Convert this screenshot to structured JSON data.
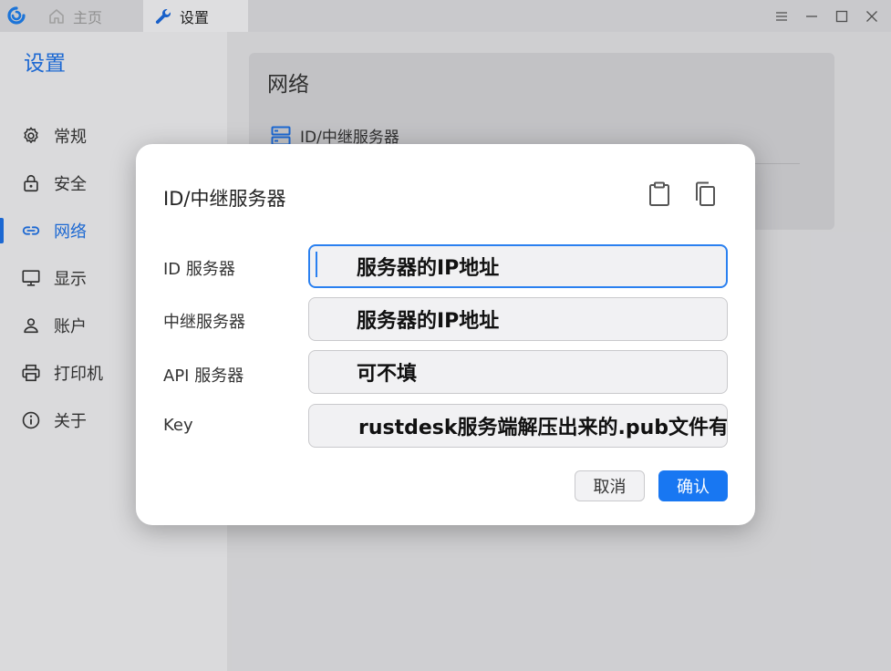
{
  "titlebar": {
    "tabs": [
      {
        "label": "主页",
        "icon": "home-icon"
      },
      {
        "label": "设置",
        "icon": "wrench-icon"
      }
    ]
  },
  "sidebar": {
    "title": "设置",
    "items": [
      {
        "label": "常规",
        "icon": "gear-icon"
      },
      {
        "label": "安全",
        "icon": "lock-icon"
      },
      {
        "label": "网络",
        "icon": "link-icon",
        "active": true
      },
      {
        "label": "显示",
        "icon": "monitor-icon"
      },
      {
        "label": "账户",
        "icon": "user-icon"
      },
      {
        "label": "打印机",
        "icon": "printer-icon"
      },
      {
        "label": "关于",
        "icon": "info-icon"
      }
    ]
  },
  "main": {
    "card_title": "网络",
    "server_row_label": "ID/中继服务器"
  },
  "dialog": {
    "title": "ID/中继服务器",
    "fields": [
      {
        "label": "ID 服务器",
        "value": "服务器的IP地址"
      },
      {
        "label": "中继服务器",
        "value": "服务器的IP地址"
      },
      {
        "label": "API 服务器",
        "value": "可不填"
      },
      {
        "label": "Key",
        "value": "rustdesk服务端解压出来的.pub文件有"
      }
    ],
    "cancel_label": "取消",
    "ok_label": "确认"
  },
  "colors": {
    "accent": "#1e6fe0",
    "primary_button": "#1877f2"
  }
}
